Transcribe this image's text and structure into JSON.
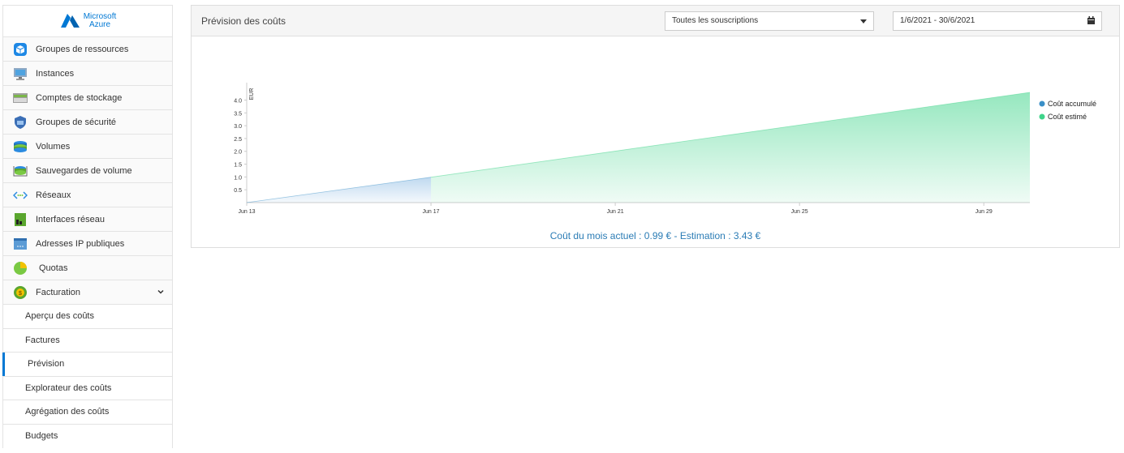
{
  "logo": {
    "line1": "Microsoft",
    "line2": "Azure"
  },
  "sidebar": {
    "items": [
      {
        "label": "Groupes de ressources",
        "icon": "resource-group-icon"
      },
      {
        "label": "Instances",
        "icon": "monitor-icon"
      },
      {
        "label": "Comptes de stockage",
        "icon": "storage-icon"
      },
      {
        "label": "Groupes de sécurité",
        "icon": "shield-icon"
      },
      {
        "label": "Volumes",
        "icon": "disk-icon"
      },
      {
        "label": "Sauvegardes de volume",
        "icon": "backup-icon"
      },
      {
        "label": "Réseaux",
        "icon": "network-icon"
      },
      {
        "label": "Interfaces réseau",
        "icon": "nic-icon"
      },
      {
        "label": "Adresses IP publiques",
        "icon": "ip-icon"
      },
      {
        "label": "Quotas",
        "icon": "pie-icon"
      },
      {
        "label": "Facturation",
        "icon": "billing-icon"
      }
    ],
    "billing_sub": [
      {
        "label": "Aperçu des coûts"
      },
      {
        "label": "Factures"
      },
      {
        "label": "Prévision"
      },
      {
        "label": "Explorateur des coûts"
      },
      {
        "label": "Agrégation des coûts"
      },
      {
        "label": "Budgets"
      }
    ]
  },
  "panel": {
    "title": "Prévision des coûts",
    "subscription_select": "Toutes les souscriptions",
    "date_range": "1/6/2021 - 30/6/2021",
    "summary": "Coût du mois actuel : 0.99 € - Estimation : 3.43 €"
  },
  "colors": {
    "accent": "#0078d4",
    "accumulated": "#3a8fc7",
    "estimated": "#3fd48a"
  },
  "chart_data": {
    "type": "area",
    "ylabel": "EUR",
    "yticks": [
      "0.5",
      "1.0",
      "1.5",
      "2.0",
      "2.5",
      "3.0",
      "3.5",
      "4.0"
    ],
    "xticks": [
      "Jun 13",
      "Jun 17",
      "Jun 21",
      "Jun 25",
      "Jun 29"
    ],
    "ylim": [
      0,
      4.3
    ],
    "series": [
      {
        "name": "Coût accumulé",
        "x": [
          "Jun 13",
          "Jun 17"
        ],
        "values": [
          0,
          0.99
        ]
      },
      {
        "name": "Coût estimé",
        "x": [
          "Jun 17",
          "Jun 30"
        ],
        "values": [
          0.99,
          4.3
        ]
      }
    ],
    "legend": "right"
  }
}
